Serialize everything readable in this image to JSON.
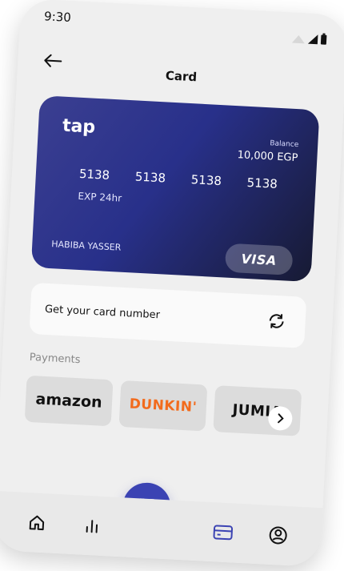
{
  "status": {
    "time": "9:30"
  },
  "header": {
    "title": "Card"
  },
  "card": {
    "brand": "tap",
    "balance_label": "Balance",
    "balance_value": "10,000 EGP",
    "numbers": [
      "5138",
      "5138",
      "5138",
      "5138"
    ],
    "expiry": "EXP 24hr",
    "holder": "HABIBA YASSER",
    "network": "VISA"
  },
  "get_card_number": {
    "label": "Get your card number"
  },
  "payments": {
    "title": "Payments",
    "merchants": [
      "amazon",
      "DUNKIN'",
      "JUMIA"
    ]
  },
  "icons": {
    "back": "arrow-left-icon",
    "refresh": "refresh-icon",
    "next": "chevron-right-icon",
    "scan": "scan-icon",
    "home": "home-icon",
    "stats": "chart-icon",
    "card": "card-icon",
    "profile": "user-icon"
  },
  "colors": {
    "accent": "#3b43b3",
    "card_start": "#3b3f91",
    "card_end": "#171a33",
    "dunkin": "#f26b1d"
  }
}
